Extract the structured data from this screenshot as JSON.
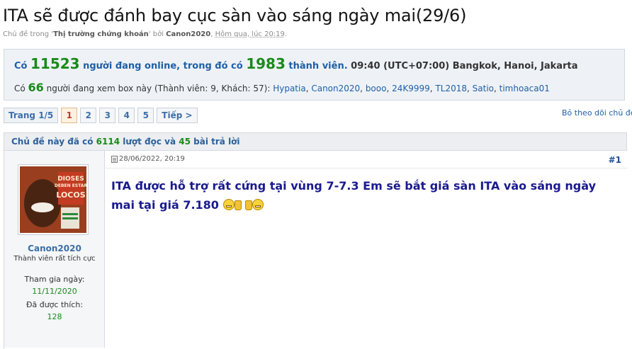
{
  "thread": {
    "title": "ITA sẽ được đánh bay cục sàn vào sáng ngày mai(29/6)",
    "meta_prefix": "Chủ đề trong '",
    "forum": "Thị trường chứng khoán",
    "meta_mid": "' bởi ",
    "author": "Canon2020",
    "meta_sep": ", ",
    "date": "Hôm qua, lúc 20:19",
    "meta_end": "."
  },
  "online": {
    "prefix": "Có ",
    "online_count": "11523",
    "mid": " người đang online, trong đó có ",
    "member_count": "1983",
    "suffix": " thành viên.",
    "time": " 09:40 (UTC+07:00) Bangkok, Hanoi, Jakarta",
    "viewing_prefix": "Có ",
    "viewing_count": "66",
    "viewing_text": " người đang xem box này (Thành viên: 9, Khách: 57): ",
    "users": [
      "Hypatia",
      "Canon2020",
      "booo",
      "24K9999",
      "TL2018",
      "Satio",
      "timhoaca01"
    ]
  },
  "pagination": {
    "label": "Trang 1/5",
    "pages": [
      "1",
      "2",
      "3",
      "4",
      "5"
    ],
    "current": "1",
    "next": "Tiếp >"
  },
  "follow_label": "Bỏ theo dõi chủ đề",
  "stats": {
    "prefix": "Chủ đề này đã có ",
    "views": "6114",
    "mid": " lượt đọc và ",
    "replies": "45",
    "suffix": " bài trả lời"
  },
  "post": {
    "timestamp": "28/06/2022, 20:19",
    "number": "#1",
    "body": "ITA được hỗ trợ rất cứng tại vùng 7-7.3 Em sẽ bắt giá sàn ITA vào sáng ngày mai tại giá 7.180",
    "author": {
      "name": "Canon2020",
      "title": "Thành viên rất tích cực",
      "joined_label": "Tham gia ngày:",
      "joined": "11/11/2020",
      "likes_label": "Đã được thích:",
      "likes": "128"
    }
  },
  "avatar_text": "DIOSES DEBEN ESTAR LOCOS",
  "colors": {
    "link": "#1f5fa6",
    "count_green": "#1a8a1a",
    "post_text": "#1a1a8f",
    "current_page": "#c43434"
  }
}
